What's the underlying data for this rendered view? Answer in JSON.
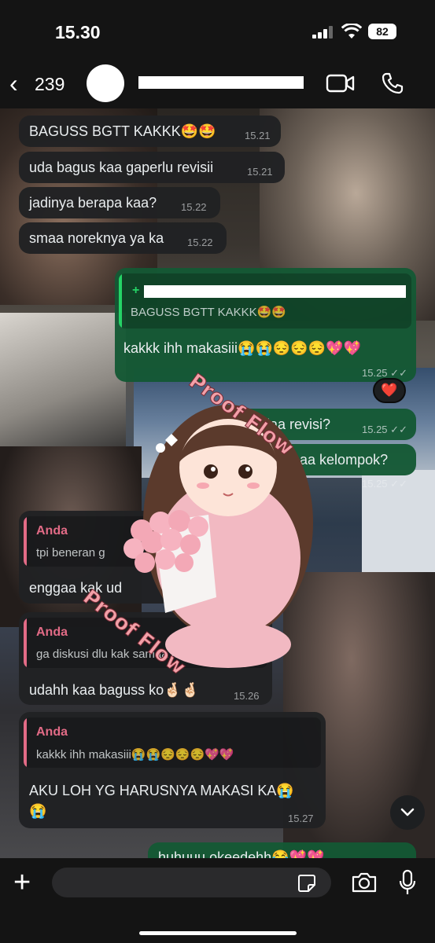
{
  "status_bar": {
    "time": "15.30",
    "battery": "82"
  },
  "header": {
    "back_count": "239"
  },
  "watermark": "Proof Flow",
  "messages": [
    {
      "text": "BAGUSS BGTT KAKKK🤩🤩",
      "time": "15.21"
    },
    {
      "text": "uda bagus kaa gaperlu revisii",
      "time": "15.21"
    },
    {
      "text": "jadinya berapa kaa?",
      "time": "15.22"
    },
    {
      "text": "smaa noreknya ya ka",
      "time": "15.22"
    },
    {
      "quote_text": "BAGUSS BGTT KAKKK🤩🤩",
      "text": "kakkk ihh makasiii😭😭😔😔😔💖💖",
      "time": "15.25"
    },
    {
      "text": "ga diaa revisi?",
      "time": "15.25",
      "reaction": "❤️"
    },
    {
      "text": "ah samaa kelompok?",
      "time": "15.25"
    },
    {
      "quote_author": "Anda",
      "quote_text": "tpi beneran g",
      "text": "enggaa kak ud",
      "time": ""
    },
    {
      "quote_author": "Anda",
      "quote_text": "ga diskusi dlu kak samaa kelompok?",
      "text": "udahh kaa baguss ko🤞🏻🤞🏻",
      "time": "15.26"
    },
    {
      "quote_author": "Anda",
      "quote_text": "kakkk ihh makasiii😭😭😔😔😔💖💖",
      "text": "AKU LOH YG HARUSNYA MAKASI KA😭",
      "text2": "😭",
      "time": "15.27"
    },
    {
      "text": "huhuuu okeedehh😂💖💖",
      "time": ""
    }
  ],
  "icons": [
    "back-chevron-icon",
    "video-call-icon",
    "phone-icon",
    "plus-icon",
    "sticker-icon",
    "camera-icon",
    "microphone-icon",
    "chevron-down-icon",
    "heart-reaction-icon"
  ],
  "colors": {
    "incoming": "#202123",
    "outgoing": "#145834",
    "accent_green": "#25d366",
    "quote_author": "#e26b86"
  }
}
